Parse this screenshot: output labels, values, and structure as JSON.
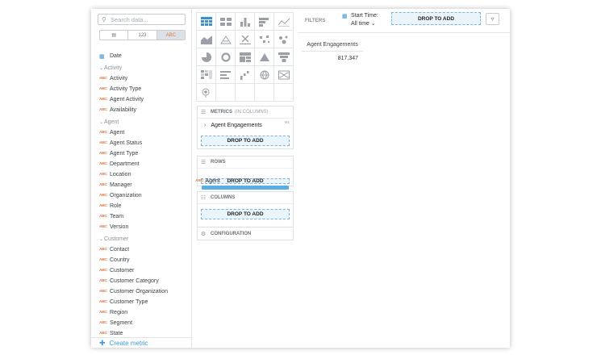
{
  "search": {
    "placeholder": "Search data..."
  },
  "type_filter": [
    "",
    "123",
    "ABC"
  ],
  "fields": {
    "date": "Date",
    "groups": [
      {
        "name": "Activity",
        "items": [
          "Activity",
          "Activity Type",
          "Agent Activity",
          "Availability"
        ]
      },
      {
        "name": "Agent",
        "items": [
          "Agent",
          "Agent Status",
          "Agent Type",
          "Department",
          "Location",
          "Manager",
          "Organization",
          "Role",
          "Team",
          "Version"
        ]
      },
      {
        "name": "Customer",
        "items": [
          "Contact",
          "Country",
          "Customer",
          "Customer Category",
          "Customer Organization",
          "Customer Type",
          "Region",
          "Segment",
          "State"
        ]
      }
    ],
    "attr_tag": "ABC"
  },
  "create_metric": "Create metric",
  "buckets": {
    "metrics": {
      "title": "METRICS",
      "subtitle": "(IN COLUMNS)",
      "item": "Agent Engagements",
      "item_badge": "M1",
      "drop": "DROP TO ADD"
    },
    "rows": {
      "title": "ROWS",
      "drop": "DROP TO ADD"
    },
    "columns": {
      "title": "COLUMNS",
      "drop": "DROP TO ADD"
    },
    "configuration": {
      "title": "CONFIGURATION"
    }
  },
  "dragging": {
    "tag": "ABC",
    "label": "Agent"
  },
  "filters": {
    "label": "FILTERS",
    "date_title": "Start Time:",
    "date_value": "All time",
    "drop": "DROP TO ADD"
  },
  "table": {
    "header": "Agent Engagements",
    "value": "817,347"
  },
  "colors": {
    "accent": "#3b8fd0",
    "attribute_tag": "#e27a3d",
    "dropzone_border": "#79b6e3"
  }
}
